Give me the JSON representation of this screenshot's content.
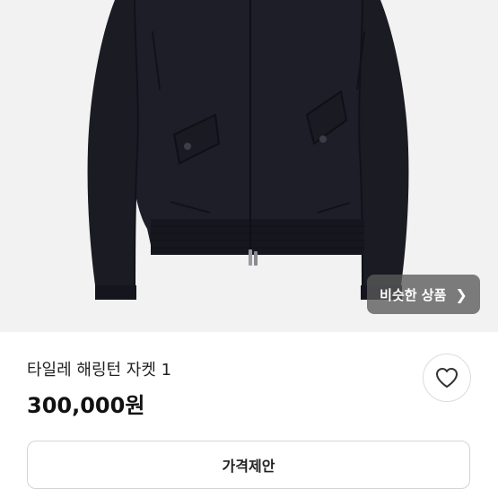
{
  "similar_button": {
    "label": "비슷한 상품",
    "icon": "chevron-right-icon"
  },
  "product": {
    "title": "타일레 해링턴 자켓 1",
    "price": "300,000원"
  },
  "like_button": {
    "icon": "heart-icon"
  },
  "offer_button": {
    "label": "가격제안"
  }
}
